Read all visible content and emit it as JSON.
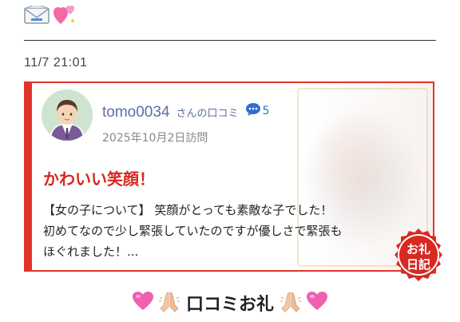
{
  "header": {
    "icons": [
      "envelope-icon",
      "sparkling-heart-icon"
    ]
  },
  "post": {
    "timestamp": "11/7 21:01"
  },
  "review": {
    "username": "tomo0034",
    "suffix": "さんの口コミ",
    "comment_count": "5",
    "visit_date": "2025年10月2日訪問",
    "title": "かわいい笑顔！",
    "body": "【女の子について】 笑顔がとっても素敵な子でした！ 初めてなので少し緊張していたのですが優しさで緊張もほぐれました！...",
    "seal_text": "お礼日記"
  },
  "footer": {
    "label": "口コミお礼",
    "icons": [
      "pink-heart-icon",
      "pray-hands-icon",
      "pray-hands-icon",
      "pink-heart-icon"
    ]
  },
  "colors": {
    "accent_red": "#e0342b",
    "username_blue": "#5b6fa6",
    "title_red": "#d6281f"
  }
}
